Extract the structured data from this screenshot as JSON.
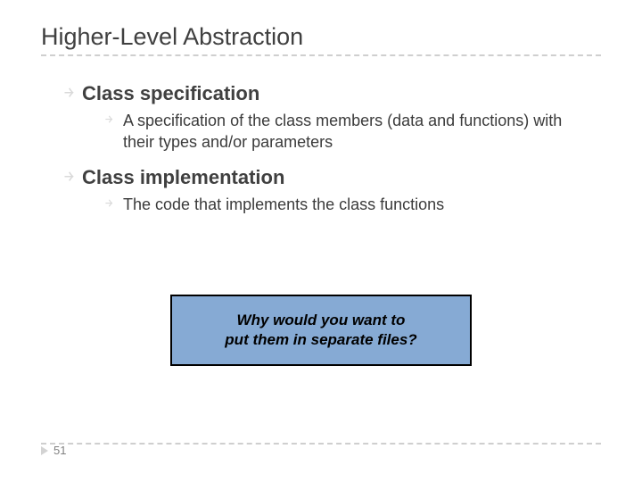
{
  "title": "Higher-Level Abstraction",
  "items": [
    {
      "heading": "Class specification",
      "sub": "A specification of the class members (data and functions) with their types and/or parameters"
    },
    {
      "heading": "Class implementation",
      "sub": "The code that implements the class functions"
    }
  ],
  "callout": {
    "line1": "Why  would you want to",
    "line2": "put them in separate files?"
  },
  "page_number": "51"
}
